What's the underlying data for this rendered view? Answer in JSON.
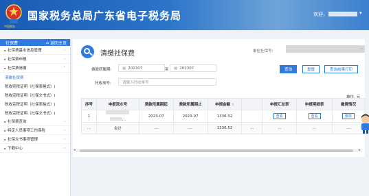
{
  "header": {
    "title": "国家税务总局广东省电子税务局",
    "logo_text": "中国税务",
    "welcome": "欢迎，"
  },
  "sidebar": {
    "head": "社保费",
    "home_link": "返回主页",
    "items": [
      {
        "label": "社保费基本信息管理"
      },
      {
        "label": "社保费申报"
      },
      {
        "label": "社保费清缴"
      }
    ],
    "subitems": [
      {
        "label": "清缴社保费",
        "active": true
      },
      {
        "label": "税收完税证明（社保表格式）(",
        "active": false
      },
      {
        "label": "税收完税证明（社保文书式）(",
        "active": false
      },
      {
        "label": "税收完税证明（社保表格式）(",
        "active": false
      },
      {
        "label": "税收完税证明（社保文书式）(",
        "active": false
      }
    ],
    "items_after": [
      {
        "label": "社保费查询"
      },
      {
        "label": "特定人员事项工伤保险"
      },
      {
        "label": "社保文书事项管理"
      },
      {
        "label": "下载中心"
      }
    ]
  },
  "main": {
    "title": "清缴社保费",
    "unit_label": "单位社保号:",
    "period_label": "费款所属期:",
    "period_start": "202307",
    "period_to": "至",
    "period_end": "202307",
    "receipt_label": "托收单号:",
    "receipt_placeholder": "请输入托收单号",
    "buttons": {
      "query": "查询",
      "reset": "重置",
      "print": "查询结果打印"
    },
    "unit_note": "单位: 元"
  },
  "table": {
    "headers": [
      "序号",
      "申报流水号",
      "费款所属期起",
      "费款所属期止",
      "申报金额",
      "",
      "申报汇总表",
      "申报明细表",
      "缴费情况"
    ],
    "rows": [
      {
        "index": "1",
        "serial_suffix": "…",
        "start": "2023-07",
        "end": "2023-07",
        "amount": "1336.52",
        "empty": "",
        "summary": "查看",
        "detail": "查看",
        "pay": "缴款"
      }
    ],
    "total": {
      "index": "...",
      "label": "合计",
      "start": "...",
      "end": "...",
      "amount": "1336.52",
      "empty": "...",
      "summary": "...",
      "detail": "...",
      "pay": "..."
    }
  },
  "icons": [
    "tax-emblem-icon",
    "home-icon",
    "search-icon",
    "calendar-icon",
    "chevron-down-icon",
    "sort-icon",
    "assistant-mascot-icon"
  ],
  "colors": {
    "header": "#1a5bb5",
    "accent": "#2d7be0",
    "mask": "#d8d8d8"
  }
}
